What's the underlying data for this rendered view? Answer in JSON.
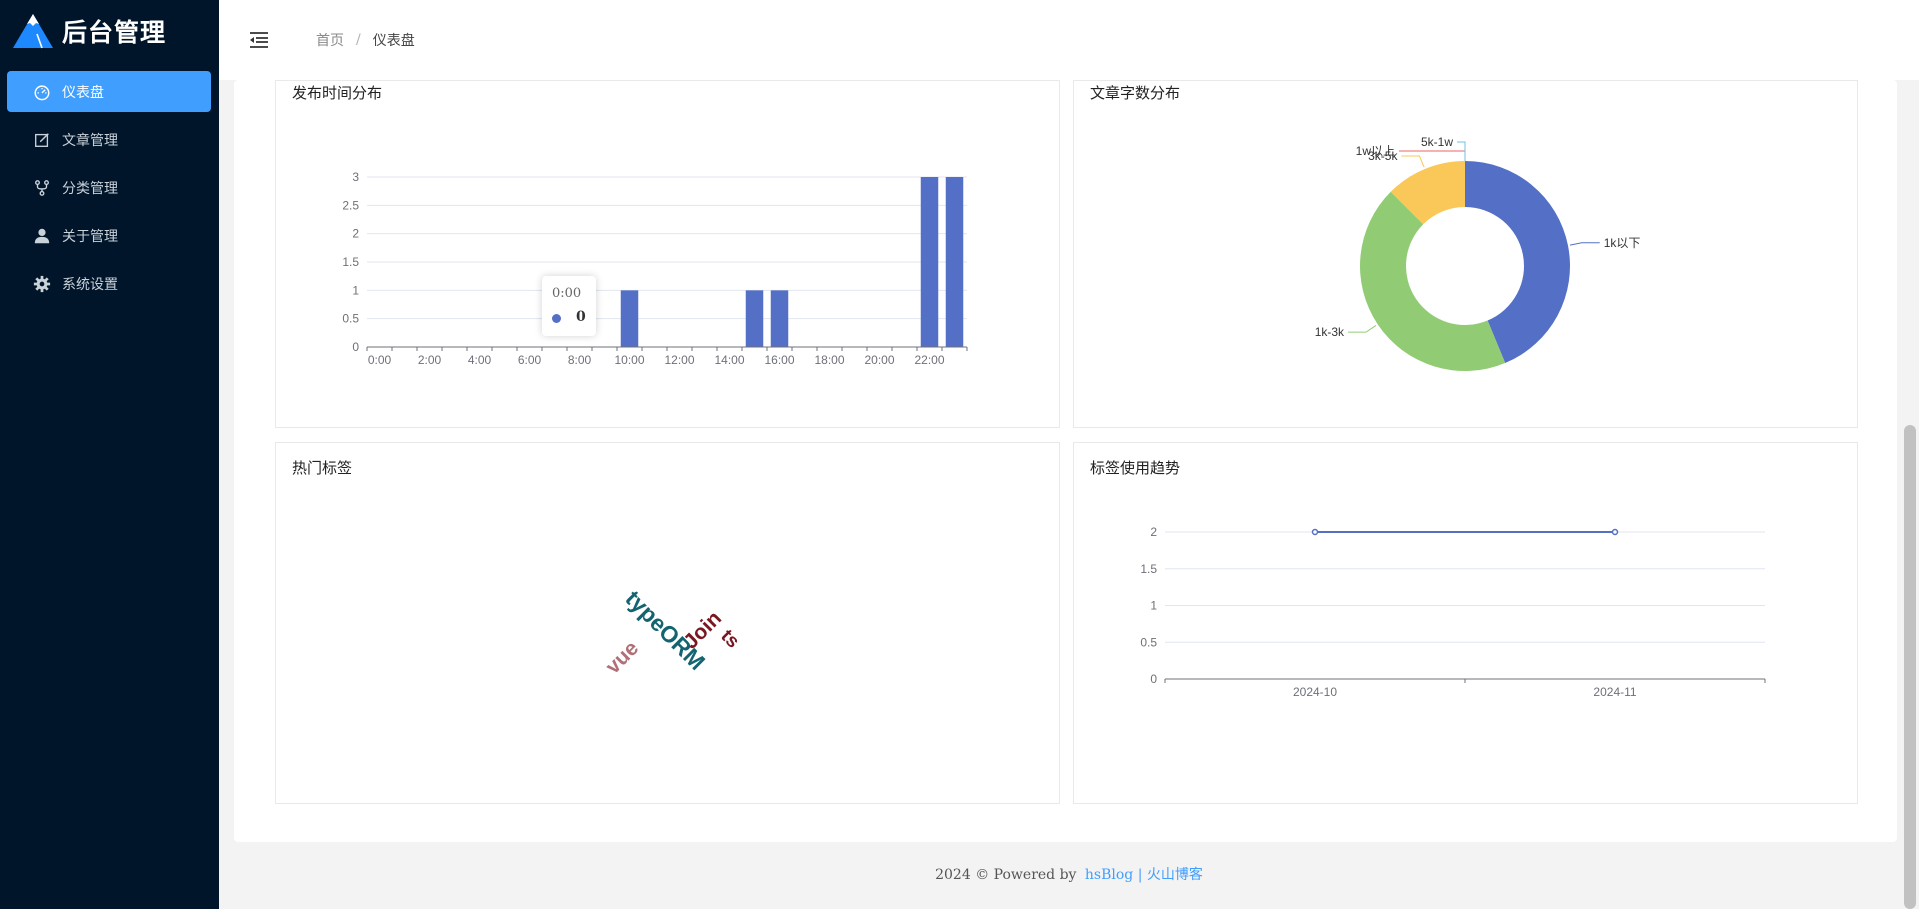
{
  "app": {
    "title": "后台管理"
  },
  "sidebar": {
    "items": [
      {
        "label": "仪表盘",
        "icon": "dashboard-icon",
        "active": true
      },
      {
        "label": "文章管理",
        "icon": "edit-icon"
      },
      {
        "label": "分类管理",
        "icon": "fork-icon"
      },
      {
        "label": "关于管理",
        "icon": "user-icon"
      },
      {
        "label": "系统设置",
        "icon": "gear-icon"
      }
    ]
  },
  "breadcrumb": {
    "home": "首页",
    "separator": "/",
    "current": "仪表盘"
  },
  "panels": {
    "publish_time": {
      "title": "发布时间分布"
    },
    "word_count": {
      "title": "文章字数分布"
    },
    "hot_tags": {
      "title": "热门标签"
    },
    "tag_trend": {
      "title": "标签使用趋势"
    }
  },
  "tooltip": {
    "label": "0:00",
    "value": "0"
  },
  "word_cloud": {
    "words": [
      "typeORM",
      "Join",
      "ts",
      "vue"
    ]
  },
  "footer": {
    "prefix": "2024 © Powered by",
    "link1": "hsBlog",
    "separator": "|",
    "link2": "火山博客"
  },
  "colors": {
    "sidebar": "#001529",
    "accent": "#409eff",
    "series_blue": "#5470c6",
    "green": "#91cc75",
    "yellow": "#fac858",
    "red": "#ee6666",
    "cyan": "#73c0de"
  },
  "chart_data": [
    {
      "type": "bar",
      "title": "发布时间分布",
      "categories": [
        "0:00",
        "1:00",
        "2:00",
        "3:00",
        "4:00",
        "5:00",
        "6:00",
        "7:00",
        "8:00",
        "9:00",
        "10:00",
        "11:00",
        "12:00",
        "13:00",
        "14:00",
        "15:00",
        "16:00",
        "17:00",
        "18:00",
        "19:00",
        "20:00",
        "21:00",
        "22:00",
        "23:00"
      ],
      "x_tick_labels": [
        "0:00",
        "2:00",
        "4:00",
        "6:00",
        "8:00",
        "10:00",
        "12:00",
        "14:00",
        "16:00",
        "18:00",
        "20:00",
        "22:00"
      ],
      "values": [
        0,
        0,
        0,
        0,
        0,
        0,
        0,
        0,
        0,
        0,
        1,
        0,
        0,
        0,
        0,
        1,
        1,
        0,
        0,
        0,
        0,
        0,
        3,
        3
      ],
      "y_ticks": [
        "0",
        "0.5",
        "1",
        "1.5",
        "2",
        "2.5",
        "3"
      ],
      "ylim": [
        0,
        3
      ],
      "grid": true
    },
    {
      "type": "pie",
      "title": "文章字数分布",
      "donut": true,
      "slices": [
        {
          "name": "1k以下",
          "value": 7
        },
        {
          "name": "1k-3k",
          "value": 7
        },
        {
          "name": "3k-5k",
          "value": 2
        },
        {
          "name": "1w以上",
          "value": 0
        },
        {
          "name": "5k-1w",
          "value": 0
        }
      ]
    },
    {
      "type": "line",
      "title": "标签使用趋势",
      "categories": [
        "2024-10",
        "2024-11"
      ],
      "series": [
        {
          "values": [
            2,
            2
          ]
        }
      ],
      "y_ticks": [
        "0",
        "0.5",
        "1",
        "1.5",
        "2"
      ],
      "ylim": [
        0,
        2
      ],
      "grid": true
    }
  ]
}
